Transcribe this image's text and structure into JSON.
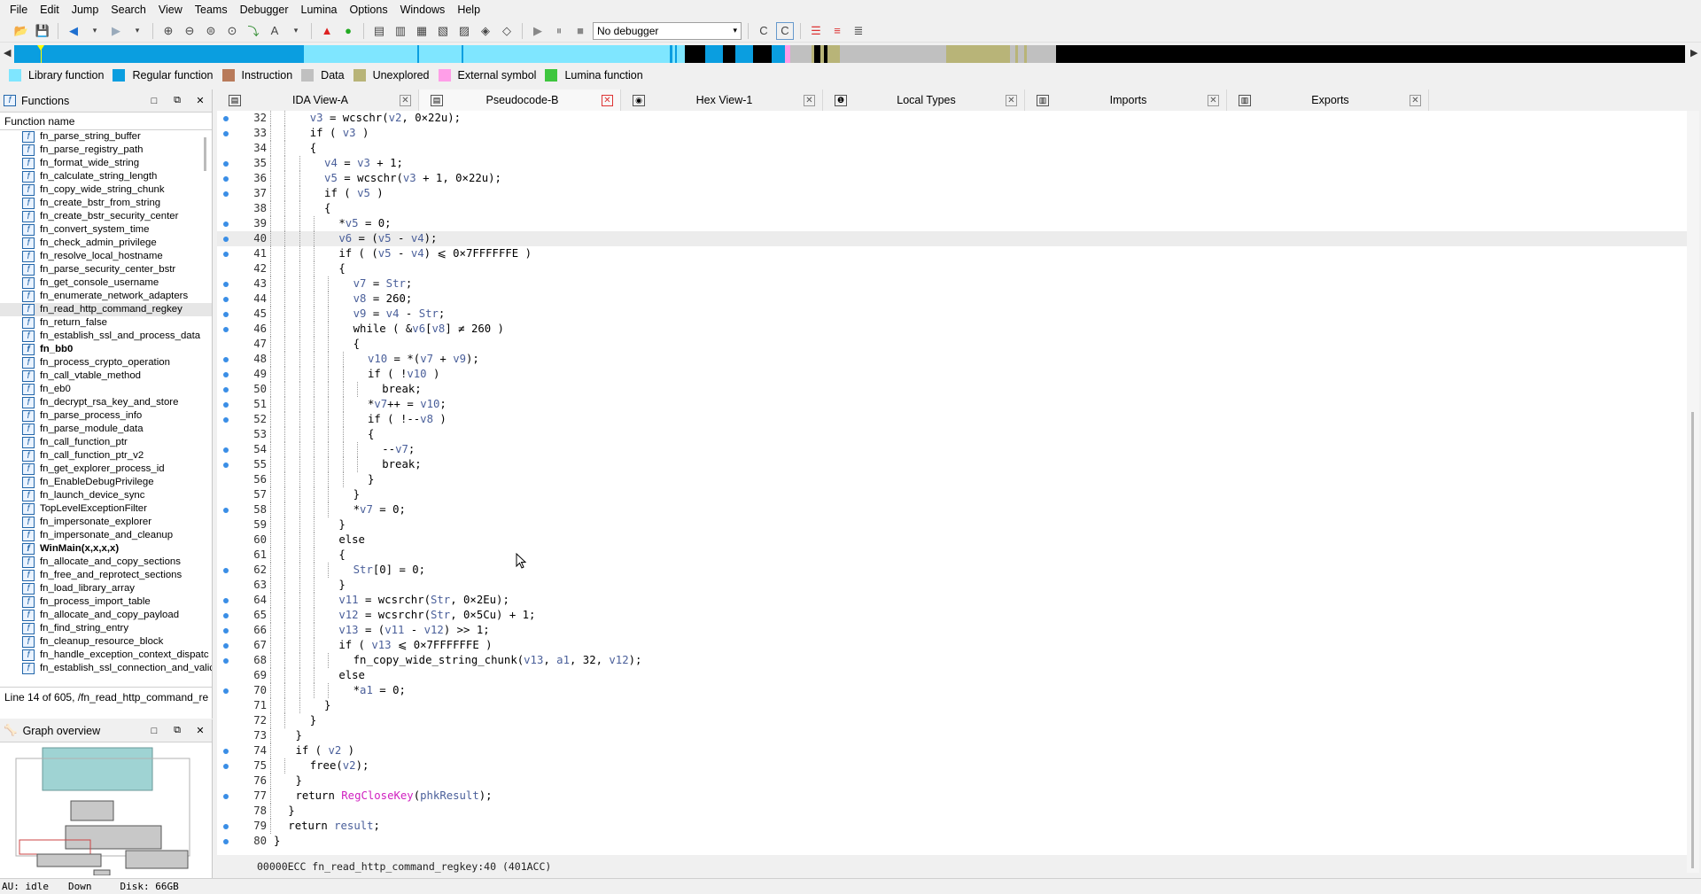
{
  "menu": [
    "File",
    "Edit",
    "Jump",
    "Search",
    "View",
    "Teams",
    "Debugger",
    "Lumina",
    "Options",
    "Windows",
    "Help"
  ],
  "toolbar": {
    "debugger_select": "No debugger"
  },
  "legend": [
    {
      "label": "Library function",
      "color": "#7fe6ff"
    },
    {
      "label": "Regular function",
      "color": "#0a9ee0"
    },
    {
      "label": "Instruction",
      "color": "#b87a5a"
    },
    {
      "label": "Data",
      "color": "#c0c0c0"
    },
    {
      "label": "Unexplored",
      "color": "#b8b478"
    },
    {
      "label": "External symbol",
      "color": "#ff9ee8"
    },
    {
      "label": "Lumina function",
      "color": "#3ec63e"
    }
  ],
  "functions_panel": {
    "title": "Functions",
    "column_header": "Function name",
    "items": [
      {
        "name": "fn_parse_string_buffer"
      },
      {
        "name": "fn_parse_registry_path"
      },
      {
        "name": "fn_format_wide_string"
      },
      {
        "name": "fn_calculate_string_length"
      },
      {
        "name": "fn_copy_wide_string_chunk"
      },
      {
        "name": "fn_create_bstr_from_string"
      },
      {
        "name": "fn_create_bstr_security_center"
      },
      {
        "name": "fn_convert_system_time"
      },
      {
        "name": "fn_check_admin_privilege"
      },
      {
        "name": "fn_resolve_local_hostname"
      },
      {
        "name": "fn_parse_security_center_bstr"
      },
      {
        "name": "fn_get_console_username"
      },
      {
        "name": "fn_enumerate_network_adapters"
      },
      {
        "name": "fn_read_http_command_regkey",
        "selected": true
      },
      {
        "name": "fn_return_false"
      },
      {
        "name": "fn_establish_ssl_and_process_data"
      },
      {
        "name": "fn_bb0",
        "bold": true
      },
      {
        "name": "fn_process_crypto_operation"
      },
      {
        "name": "fn_call_vtable_method"
      },
      {
        "name": "fn_eb0"
      },
      {
        "name": "fn_decrypt_rsa_key_and_store"
      },
      {
        "name": "fn_parse_process_info"
      },
      {
        "name": "fn_parse_module_data"
      },
      {
        "name": "fn_call_function_ptr"
      },
      {
        "name": "fn_call_function_ptr_v2"
      },
      {
        "name": "fn_get_explorer_process_id"
      },
      {
        "name": "fn_EnableDebugPrivilege"
      },
      {
        "name": "fn_launch_device_sync"
      },
      {
        "name": "TopLevelExceptionFilter"
      },
      {
        "name": "fn_impersonate_explorer"
      },
      {
        "name": "fn_impersonate_and_cleanup"
      },
      {
        "name": "WinMain(x,x,x,x)",
        "bold": true
      },
      {
        "name": "fn_allocate_and_copy_sections"
      },
      {
        "name": "fn_free_and_reprotect_sections"
      },
      {
        "name": "fn_load_library_array"
      },
      {
        "name": "fn_process_import_table"
      },
      {
        "name": "fn_allocate_and_copy_payload"
      },
      {
        "name": "fn_find_string_entry"
      },
      {
        "name": "fn_cleanup_resource_block"
      },
      {
        "name": "fn_handle_exception_context_dispatc"
      },
      {
        "name": "fn_establish_ssl_connection_and_valic"
      }
    ],
    "status": "Line 14 of 605, /fn_read_http_command_re"
  },
  "graph_overview": {
    "title": "Graph overview"
  },
  "tabs": [
    {
      "label": "IDA View-A",
      "icon": "ida-view-icon"
    },
    {
      "label": "Pseudocode-B",
      "icon": "pseudocode-icon",
      "active": true
    },
    {
      "label": "Hex View-1",
      "icon": "hex-view-icon"
    },
    {
      "label": "Local Types",
      "icon": "local-types-icon"
    },
    {
      "label": "Imports",
      "icon": "imports-icon"
    },
    {
      "label": "Exports",
      "icon": "exports-icon"
    }
  ],
  "code": {
    "lines": [
      {
        "n": "32",
        "dot": true,
        "d": 2,
        "t": "v3 = wcschr(v2, 0×22u);"
      },
      {
        "n": "33",
        "dot": true,
        "d": 2,
        "t": "if ( v3 )"
      },
      {
        "n": "34",
        "dot": false,
        "d": 2,
        "t": "{"
      },
      {
        "n": "35",
        "dot": true,
        "d": 3,
        "t": "v4 = v3 + 1;"
      },
      {
        "n": "36",
        "dot": true,
        "d": 3,
        "t": "v5 = wcschr(v3 + 1, 0×22u);"
      },
      {
        "n": "37",
        "dot": true,
        "d": 3,
        "t": "if ( v5 )"
      },
      {
        "n": "38",
        "dot": false,
        "d": 3,
        "t": "{"
      },
      {
        "n": "39",
        "dot": true,
        "d": 4,
        "t": "*v5 = 0;"
      },
      {
        "n": "40",
        "dot": true,
        "d": 4,
        "t": "v6 = (v5 - v4);",
        "hl": true
      },
      {
        "n": "41",
        "dot": true,
        "d": 4,
        "t": "if ( (v5 - v4) ⩽ 0×7FFFFFFE )"
      },
      {
        "n": "42",
        "dot": false,
        "d": 4,
        "t": "{"
      },
      {
        "n": "43",
        "dot": true,
        "d": 5,
        "t": "v7 = Str;"
      },
      {
        "n": "44",
        "dot": true,
        "d": 5,
        "t": "v8 = 260;"
      },
      {
        "n": "45",
        "dot": true,
        "d": 5,
        "t": "v9 = v4 - Str;"
      },
      {
        "n": "46",
        "dot": true,
        "d": 5,
        "t": "while ( &v6[v8] ≠ 260 )"
      },
      {
        "n": "47",
        "dot": false,
        "d": 5,
        "t": "{"
      },
      {
        "n": "48",
        "dot": true,
        "d": 6,
        "t": "v10 = *(v7 + v9);"
      },
      {
        "n": "49",
        "dot": true,
        "d": 6,
        "t": "if ( !v10 )"
      },
      {
        "n": "50",
        "dot": true,
        "d": 7,
        "t": "break;"
      },
      {
        "n": "51",
        "dot": true,
        "d": 6,
        "t": "*v7++ = v10;"
      },
      {
        "n": "52",
        "dot": true,
        "d": 6,
        "t": "if ( !--v8 )"
      },
      {
        "n": "53",
        "dot": false,
        "d": 6,
        "t": "{"
      },
      {
        "n": "54",
        "dot": true,
        "d": 7,
        "t": "--v7;"
      },
      {
        "n": "55",
        "dot": true,
        "d": 7,
        "t": "break;"
      },
      {
        "n": "56",
        "dot": false,
        "d": 6,
        "t": "}"
      },
      {
        "n": "57",
        "dot": false,
        "d": 5,
        "t": "}"
      },
      {
        "n": "58",
        "dot": true,
        "d": 5,
        "t": "*v7 = 0;"
      },
      {
        "n": "59",
        "dot": false,
        "d": 4,
        "t": "}"
      },
      {
        "n": "60",
        "dot": false,
        "d": 4,
        "t": "else"
      },
      {
        "n": "61",
        "dot": false,
        "d": 4,
        "t": "{"
      },
      {
        "n": "62",
        "dot": true,
        "d": 5,
        "t": "Str[0] = 0;"
      },
      {
        "n": "63",
        "dot": false,
        "d": 4,
        "t": "}"
      },
      {
        "n": "64",
        "dot": true,
        "d": 4,
        "t": "v11 = wcsrchr(Str, 0×2Eu);"
      },
      {
        "n": "65",
        "dot": true,
        "d": 4,
        "t": "v12 = wcsrchr(Str, 0×5Cu) + 1;"
      },
      {
        "n": "66",
        "dot": true,
        "d": 4,
        "t": "v13 = (v11 - v12) >> 1;"
      },
      {
        "n": "67",
        "dot": true,
        "d": 4,
        "t": "if ( v13 ⩽ 0×7FFFFFFE )"
      },
      {
        "n": "68",
        "dot": true,
        "d": 5,
        "t": "fn_copy_wide_string_chunk(v13, a1, 32, v12);"
      },
      {
        "n": "69",
        "dot": false,
        "d": 4,
        "t": "else"
      },
      {
        "n": "70",
        "dot": true,
        "d": 5,
        "t": "*a1 = 0;"
      },
      {
        "n": "71",
        "dot": false,
        "d": 3,
        "t": "}"
      },
      {
        "n": "72",
        "dot": false,
        "d": 2,
        "t": "}"
      },
      {
        "n": "73",
        "dot": false,
        "d": 1,
        "t": "}"
      },
      {
        "n": "74",
        "dot": true,
        "d": 1,
        "t": "if ( v2 )"
      },
      {
        "n": "75",
        "dot": true,
        "d": 2,
        "t": "free(v2);"
      },
      {
        "n": "76",
        "dot": false,
        "d": 1,
        "t": "}"
      },
      {
        "n": "77",
        "dot": true,
        "d": 1,
        "t": "return RegCloseKey(phkResult);"
      },
      {
        "n": "78",
        "dot": false,
        "d": 0.5,
        "t": "}"
      },
      {
        "n": "79",
        "dot": true,
        "d": 0.5,
        "t": "return result;"
      },
      {
        "n": "80",
        "dot": true,
        "d": -0.5,
        "t": "}"
      }
    ],
    "status_line": "00000ECC fn_read_http_command_regkey:40 (401ACC)"
  },
  "statusbar": {
    "au": "AU:  idle",
    "direction": "Down",
    "disk": "Disk: 66GB"
  }
}
